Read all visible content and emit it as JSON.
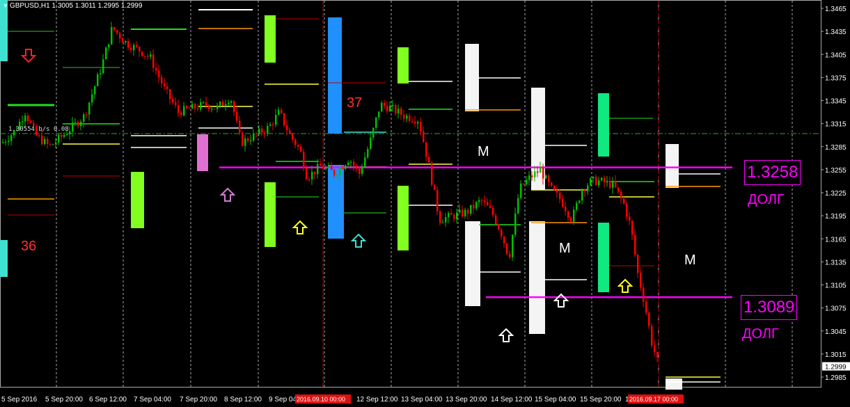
{
  "symbol_header": {
    "text": "GBPUSD,H1  1.3005 1.3011 1.2995 1.2999"
  },
  "info_overlay": "1.30554   b/s  0.08",
  "price_axis": {
    "ticks": [
      "1.3465",
      "1.3435",
      "1.3405",
      "1.3375",
      "1.3345",
      "1.3315",
      "1.3285",
      "1.3255",
      "1.3225",
      "1.3195",
      "1.3165",
      "1.3135",
      "1.3105",
      "1.3075",
      "1.3045",
      "1.3015",
      "1.2985"
    ],
    "current_price": "1.2999"
  },
  "time_axis": {
    "ticks": [
      "5 Sep 2016",
      "5 Sep 20:00",
      "6 Sep 12:00",
      "7 Sep 04:00",
      "7 Sep 20:00",
      "8 Sep 12:00",
      "9 Sep 04",
      "12 Sep 12:00",
      "13 Sep 04:00",
      "13 Sep 20:00",
      "14 Sep 12:00",
      "15 Sep 04:00",
      "15 Sep 20:00",
      "16"
    ],
    "highlight_labels": [
      "2016.09.10 00:00",
      "2016.09.17 00:00"
    ]
  },
  "levels": {
    "upper": {
      "value": "1.3258",
      "note": "ДОЛГ"
    },
    "lower": {
      "value": "1.3089",
      "note": "ДОЛГ"
    }
  },
  "counts": {
    "left": "36",
    "middle": "37"
  },
  "markers": {
    "m_label": "M"
  },
  "colors": {
    "background": "#000000",
    "bull_candle": "#00c000",
    "bear_candle": "#ff0000",
    "magenta": "#ff00ff",
    "cyan": "#40e0d0",
    "lime": "#80ff20",
    "blue": "#2090ff",
    "white": "#f4f4f4",
    "pink": "#e070d0",
    "mint": "#10e880"
  }
}
